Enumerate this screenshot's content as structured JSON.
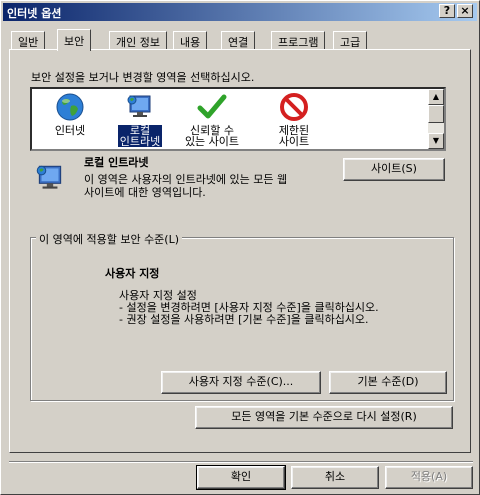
{
  "window": {
    "title": "인터넷 옵션",
    "help_label": "?",
    "close_label": "×"
  },
  "tabs": [
    "일반",
    "보안",
    "개인 정보",
    "내용",
    "연결",
    "프로그램",
    "고급"
  ],
  "active_tab": "보안",
  "security": {
    "instruction": "보안 설정을 보거나 변경할 영역을 선택하십시오.",
    "zones": [
      {
        "line1": "인터넷",
        "line2": "",
        "icon": "globe-icon"
      },
      {
        "line1": "로컬",
        "line2": "인트라넷",
        "icon": "monitor-icon",
        "selected": true
      },
      {
        "line1": "신뢰할 수",
        "line2": "있는 사이트",
        "icon": "checkmark-icon"
      },
      {
        "line1": "제한된",
        "line2": "사이트",
        "icon": "no-entry-icon"
      }
    ],
    "zone_title": "로컬 인트라넷",
    "zone_desc_line1": "이 영역은 사용자의 인트라넷에 있는 모든 웹",
    "zone_desc_line2": "사이트에 대한 영역입니다.",
    "sites_button": "사이트(S)",
    "level_group_label": "이 영역에 적용할 보안 수준(L)",
    "custom_title": "사용자 지정",
    "custom_line1": "사용자 지정 설정",
    "custom_line2": "- 설정을 변경하려면 [사용자 지정 수준]을 클릭하십시오.",
    "custom_line3": "- 권장 설정을 사용하려면 [기본 수준]을 클릭하십시오.",
    "custom_level_button": "사용자 지정 수준(C)...",
    "default_level_button": "기본 수준(D)",
    "reset_all_button": "모든 영역을 기본 수준으로 다시 설정(R)"
  },
  "footer": {
    "ok": "확인",
    "cancel": "취소",
    "apply": "적용(A)"
  },
  "colors": {
    "titlebar_start": "#0a246a",
    "titlebar_end": "#a6caf0",
    "face": "#d4d0c8",
    "selection": "#0a246a"
  }
}
